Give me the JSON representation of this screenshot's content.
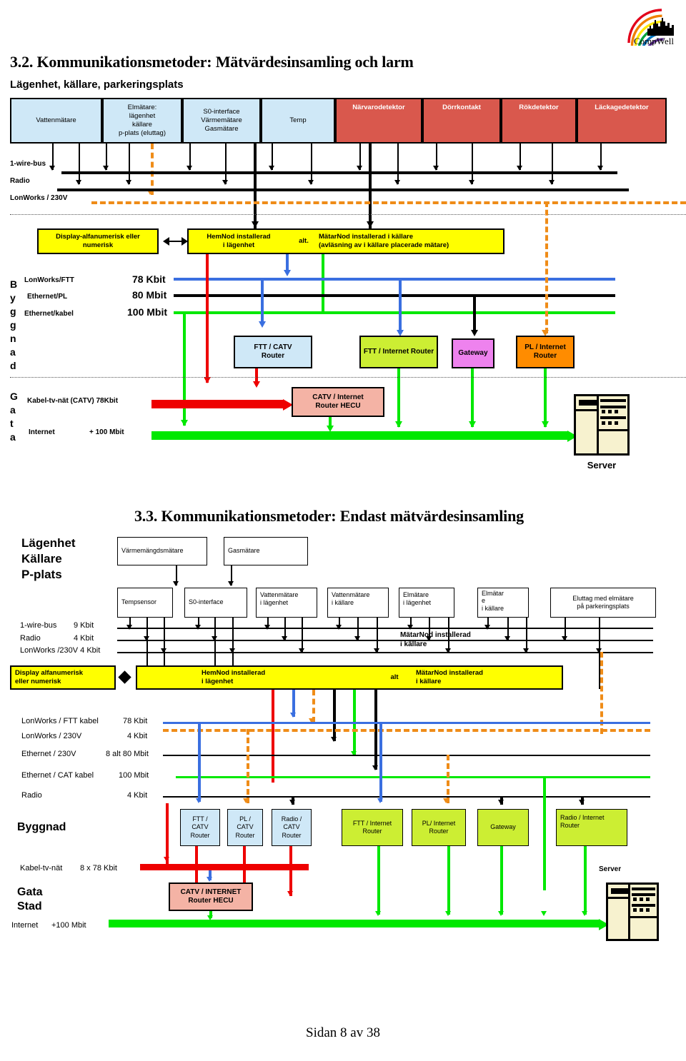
{
  "page": {
    "footer": "Sidan 8 av 38",
    "logo_text": "CompWell"
  },
  "section1": {
    "heading": "3.2. Kommunikationsmetoder: Mätvärdesinsamling och larm",
    "subheading": "Lägenhet, källare, parkeringsplats",
    "devices": [
      {
        "label": "Vattenmätare",
        "color": "#cfe8f7"
      },
      {
        "label": "Elmätare:\nlägenhet\nkällare\np-plats (eluttag)",
        "color": "#cfe8f7"
      },
      {
        "label": "S0-interface\nVärmemätare\nGasmätare",
        "color": "#cfe8f7"
      },
      {
        "label": "Temp",
        "color": "#cfe8f7"
      },
      {
        "label": "Närvarodetektor",
        "color": "#d9584d"
      },
      {
        "label": "Dörrkontakt",
        "color": "#d9584d"
      },
      {
        "label": "Rökdetektor",
        "color": "#d9584d"
      },
      {
        "label": "Läckagedetektor",
        "color": "#d9584d"
      }
    ],
    "buses": [
      {
        "label": "1-wire-bus",
        "rate": ""
      },
      {
        "label": "Radio",
        "rate": ""
      },
      {
        "label": "LonWorks / 230V",
        "rate": ""
      }
    ],
    "display_box": "Display-alfanumerisk eller\nnumerisk",
    "node_box": {
      "left": "HemNod installerad\ni lägenhet",
      "alt": "alt.",
      "right": "MätarNod installerad i källare\n(avläsning av i källare placerade mätare)"
    },
    "byggnad_label": "Byggnad",
    "gata_label": "Gata",
    "building_buses": [
      {
        "name": "LonWorks/FTT",
        "rate": "78 Kbit"
      },
      {
        "name": "Ethernet/PL",
        "rate": "80 Mbit"
      },
      {
        "name": "Ethernet/kabel",
        "rate": "100 Mbit"
      }
    ],
    "routers": [
      {
        "label": "FTT / CATV\nRouter",
        "color": "#cfe8f7"
      },
      {
        "label": "FTT / Internet Router",
        "color": "#ccee33"
      },
      {
        "label": "Gateway",
        "color": "#ee82ee"
      },
      {
        "label": "PL / Internet\nRouter",
        "color": "#ff8c00"
      }
    ],
    "street_buses": [
      {
        "name": "Kabel-tv-nät (CATV) 78Kbit",
        "rate": ""
      },
      {
        "name": "Internet",
        "rate": "+ 100 Mbit"
      }
    ],
    "hecu_box": "CATV / Internet\nRouter HECU",
    "server_label": "Server"
  },
  "section2": {
    "heading": "3.3. Kommunikationsmetoder: Endast mätvärdesinsamling",
    "zone_label": "Lägenhet\nKällare\nP-plats",
    "top_meters": [
      {
        "label": "Värmemängdsmätare"
      },
      {
        "label": "Gasmätare"
      }
    ],
    "sensors": [
      {
        "label": "Tempsensor"
      },
      {
        "label": "S0-interface"
      },
      {
        "label": "Vattenmätare\ni lägenhet"
      },
      {
        "label": "Vattenmätare\ni källare"
      },
      {
        "label": "Elmätare\ni lägenhet"
      },
      {
        "label": "Elmätar\ne\ni källare"
      },
      {
        "label": "Eluttag med elmätare\npå parkeringsplats"
      }
    ],
    "buses": [
      {
        "name": "1-wire-bus",
        "rate": "9 Kbit"
      },
      {
        "name": "Radio",
        "rate": "4 Kbit"
      },
      {
        "name": "LonWorks /230V 4 Kbit",
        "rate": ""
      }
    ],
    "matarnod_note": "MätarNod installerad\ni källare",
    "display_box": "Display alfanumerisk\neller numerisk",
    "node_box": {
      "left": "HemNod installerad\ni lägenhet",
      "alt": "alt",
      "right": "MätarNod installerad\ni källare"
    },
    "building_buses": [
      {
        "name": "LonWorks / FTT kabel",
        "rate": "78 Kbit"
      },
      {
        "name": "LonWorks / 230V",
        "rate": "4 Kbit"
      },
      {
        "name": "Ethernet / 230V",
        "rate": "8 alt 80 Mbit"
      },
      {
        "name": "Ethernet / CAT kabel",
        "rate": "100 Mbit"
      },
      {
        "name": "Radio",
        "rate": "4 Kbit"
      }
    ],
    "byggnad_label": "Byggnad",
    "routers": [
      {
        "label": "FTT /\nCATV\nRouter",
        "color": "#cfe8f7"
      },
      {
        "label": "PL /\nCATV\nRouter",
        "color": "#cfe8f7"
      },
      {
        "label": "Radio /\nCATV\nRouter",
        "color": "#cfe8f7"
      },
      {
        "label": "FTT / Internet\nRouter",
        "color": "#ccee33"
      },
      {
        "label": "PL/ Internet\nRouter",
        "color": "#ccee33"
      },
      {
        "label": "Gateway",
        "color": "#ccee33"
      },
      {
        "label": "Radio / Internet\nRouter",
        "color": "#ccee33"
      }
    ],
    "catv_bus": {
      "name": "Kabel-tv-nät",
      "rate": "8 x 78 Kbit"
    },
    "hecu_box": "CATV / INTERNET\nRouter HECU",
    "gata_label": "Gata\nStad",
    "internet_bus": {
      "name": "Internet",
      "rate": "+100 Mbit"
    },
    "server_label": "Server"
  }
}
